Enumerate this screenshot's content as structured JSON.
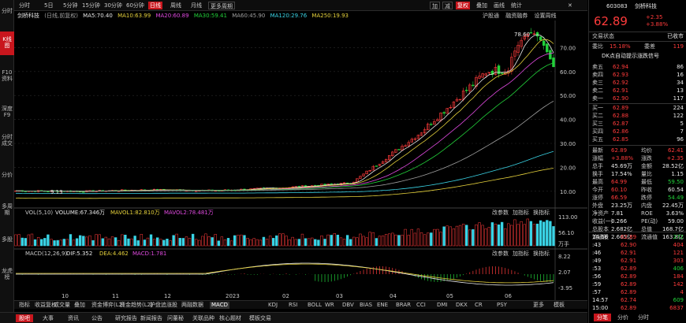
{
  "left_tabs": [
    "分时",
    "K线图",
    "F10资料",
    "深度F9",
    "分时成交",
    "分价",
    "多周期",
    "多股",
    "龙虎榜"
  ],
  "toolbar": {
    "periods": [
      "分时",
      "5日",
      "5分钟",
      "15分钟",
      "30分钟",
      "60分钟",
      "日线",
      "周线",
      "月线",
      "更多周期"
    ],
    "selected_period": "日线",
    "fq": "复权",
    "right_icons": [
      "加",
      "减",
      "复权",
      "叠加",
      "画线",
      "统计"
    ]
  },
  "ma_legend": {
    "stock": "剑桥科技",
    "mode": "(日线,前复权)",
    "ma5": "MA5:70.40",
    "ma10": "MA10:63.99",
    "ma20": "MA20:60.89",
    "ma30": "MA30:59.41",
    "ma60": "MA60:45.90",
    "ma120": "MA120:29.76",
    "ma250": "MA250:19.93"
  },
  "right_links": [
    "沪股通",
    "融资融券",
    "设置周线"
  ],
  "price_axis": [
    "70.00",
    "60.00",
    "50.00",
    "40.00",
    "30.00",
    "20.00",
    "10.00"
  ],
  "peak_label": "78.60",
  "low_label": "9.13",
  "vol_legend": {
    "title": "VOL(5,10)",
    "volume": "VOLUME:67.346万",
    "mavol1": "MAVOL1:82.810万",
    "mavol2": "MAVOL2:78.481万",
    "axis": [
      "113.00",
      "56.10",
      "万手"
    ],
    "tools": [
      "改参数",
      "加指标",
      "换指标"
    ]
  },
  "macd_legend": {
    "title": "MACD(12,26,9)",
    "dif": "DIF:5.352",
    "dea": "DEA:4.462",
    "macd": "MACD:1.781",
    "axis": [
      "8.22",
      "2.07",
      "-3.95"
    ],
    "tools": [
      "改参数",
      "加指标",
      "换指标"
    ]
  },
  "time_axis": [
    "10",
    "11",
    "12",
    "2023",
    "02",
    "03",
    "04",
    "05",
    "06"
  ],
  "indicator_tabs": [
    "指标",
    "收益复权",
    "成交量",
    "叠加",
    "资金博弈(L2)",
    "资金趋势(L2)",
    "护盘追涨股",
    "两融数据",
    "MACD",
    "KDJ",
    "RSI",
    "BOLL",
    "WR",
    "DBV",
    "BIAS",
    "ENE",
    "BRAR",
    "CCI",
    "DMI",
    "DKX",
    "CR",
    "PSY",
    "更多",
    "模板"
  ],
  "selected_indicator": "MACD",
  "bottom_tabs": [
    "股吧",
    "大事",
    "资讯",
    "公告",
    "研究报告",
    "新闻报告",
    "问董秘",
    "关联品种",
    "核心题材",
    "模板交易"
  ],
  "stock": {
    "code": "603083",
    "name": "剑桥科技",
    "price": "62.89",
    "change": "+2.35",
    "pct": "+3.88%",
    "status_label": "交易状态",
    "status_value": "已收市",
    "weibi_label": "委比",
    "weibi": "15.18%",
    "weicha_label": "委差",
    "weicha": "119",
    "signal": "DK点自动提示涨跌信号"
  },
  "asks": [
    {
      "label": "卖五",
      "price": "62.94",
      "vol": "86"
    },
    {
      "label": "卖四",
      "price": "62.93",
      "vol": "16"
    },
    {
      "label": "卖三",
      "price": "62.92",
      "vol": "34"
    },
    {
      "label": "卖二",
      "price": "62.91",
      "vol": "13"
    },
    {
      "label": "卖一",
      "price": "62.90",
      "vol": "117"
    }
  ],
  "bids": [
    {
      "label": "买一",
      "price": "62.89",
      "vol": "224"
    },
    {
      "label": "买二",
      "price": "62.88",
      "vol": "122"
    },
    {
      "label": "买三",
      "price": "62.87",
      "vol": "5"
    },
    {
      "label": "买四",
      "price": "62.86",
      "vol": "7"
    },
    {
      "label": "买五",
      "price": "62.85",
      "vol": "96"
    }
  ],
  "metrics": [
    [
      "最新",
      "62.89",
      "均价",
      "62.41"
    ],
    [
      "涨幅",
      "+3.88%",
      "涨跌",
      "+2.35"
    ],
    [
      "总手",
      "45.69万",
      "金额",
      "28.52亿"
    ],
    [
      "换手",
      "17.54%",
      "量比",
      "1.15"
    ],
    [
      "最高",
      "64.99",
      "最低",
      "59.50"
    ],
    [
      "今开",
      "60.10",
      "昨收",
      "60.54"
    ],
    [
      "涨停",
      "66.59",
      "跌停",
      "54.49"
    ],
    [
      "外盘",
      "23.25万",
      "内盘",
      "22.45万"
    ],
    [
      "净资产",
      "7.81",
      "ROE",
      "3.63%"
    ],
    [
      "收益(一)",
      "0.266",
      "PE(动)",
      "59.00"
    ],
    [
      "总股本",
      "2.682亿",
      "总值",
      "168.7亿"
    ],
    [
      "流通股",
      "2.605亿",
      "流通值",
      "163.8亿"
    ]
  ],
  "ticks": [
    {
      "time": "14:56",
      "price": "62.89",
      "dir": "up",
      "vol": "272",
      "c": "green"
    },
    {
      "time": ":43",
      "price": "62.90",
      "dir": "up",
      "vol": "404",
      "c": "red"
    },
    {
      "time": ":46",
      "price": "62.91",
      "dir": "up",
      "vol": "121",
      "c": "red"
    },
    {
      "time": ":49",
      "price": "62.91",
      "dir": "up",
      "vol": "303",
      "c": "red"
    },
    {
      "time": ":53",
      "price": "62.89",
      "dir": "up",
      "vol": "406",
      "c": "green"
    },
    {
      "time": ":56",
      "price": "62.89",
      "dir": "up",
      "vol": "184",
      "c": "red"
    },
    {
      "time": ":59",
      "price": "62.89",
      "dir": "up",
      "vol": "142",
      "c": "red"
    },
    {
      "time": ":57",
      "price": "62.89",
      "dir": "up",
      "vol": "4",
      "c": "red"
    },
    {
      "time": "14:57",
      "price": "62.74",
      "dir": "up",
      "vol": "609",
      "c": "green"
    },
    {
      "time": "15:00",
      "price": "62.89",
      "dir": "up",
      "vol": "6837",
      "c": "red"
    }
  ],
  "right_bottom_tabs": [
    "分笔",
    "分价",
    "分时"
  ],
  "chart_data": {
    "type": "line",
    "note_series": "daily closing price path approximated from candlestick chart",
    "x": [
      "10",
      "11",
      "12",
      "2023",
      "02",
      "03",
      "04",
      "05",
      "06"
    ],
    "series": [
      {
        "name": "收盘",
        "values": [
          10.2,
          10.0,
          10.6,
          10.3,
          11.5,
          13.5,
          34.0,
          60.0,
          63.0
        ]
      }
    ],
    "ylim": [
      5,
      80
    ]
  },
  "colors": {
    "up": "#ff3b3b",
    "down": "#22d13a",
    "ma5": "#e8e8e8",
    "ma10": "#e6d23c",
    "ma20": "#e04ae0",
    "ma30": "#22d13a",
    "ma60": "#a0a0a0",
    "ma120": "#3ad4e6",
    "ma250": "#e6d23c"
  }
}
